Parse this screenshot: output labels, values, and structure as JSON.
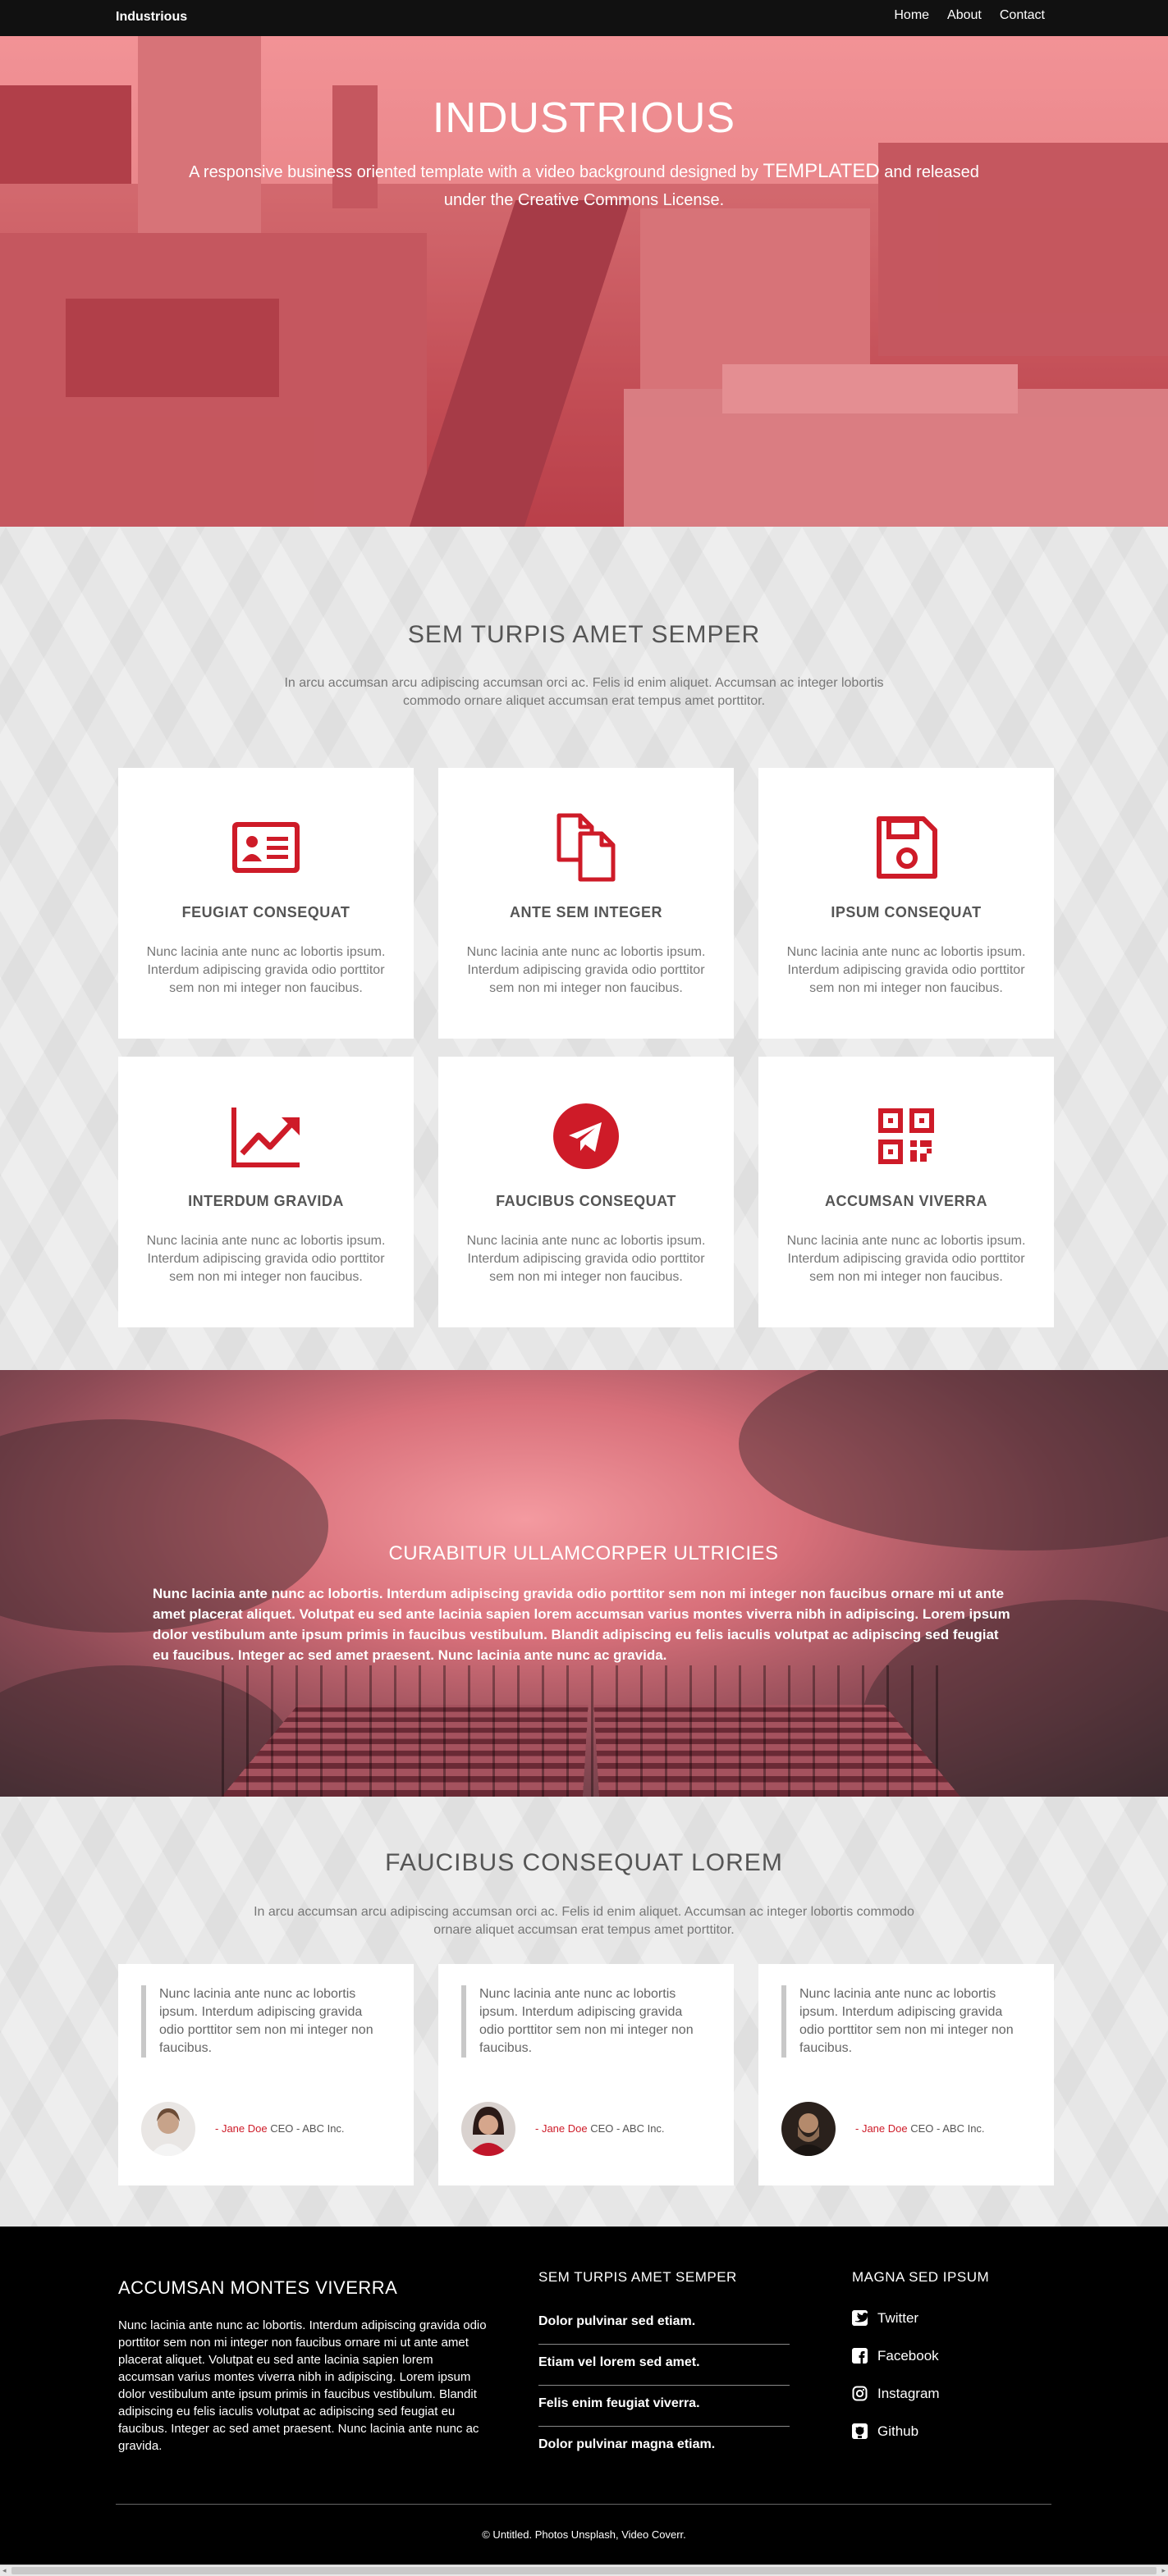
{
  "header": {
    "logo": "Industrious",
    "nav": [
      "Home",
      "About",
      "Contact"
    ]
  },
  "banner": {
    "title": "INDUSTRIOUS",
    "text_before": "A responsive business oriented template with a video background designed by ",
    "templated": "TEMPLATED",
    "text_after": " and released under the Creative Commons License."
  },
  "features": {
    "title": "SEM TURPIS AMET SEMPER",
    "description": "In arcu accumsan arcu adipiscing accumsan orci ac. Felis id enim aliquet. Accumsan ac integer lobortis commodo ornare aliquet accumsan erat tempus amet porttitor.",
    "cards": [
      {
        "icon": "id-card-icon",
        "title": "FEUGIAT CONSEQUAT",
        "text": "Nunc lacinia ante nunc ac lobortis ipsum. Interdum adipiscing gravida odio porttitor sem non mi integer non faucibus."
      },
      {
        "icon": "copy-files-icon",
        "title": "ANTE SEM INTEGER",
        "text": "Nunc lacinia ante nunc ac lobortis ipsum. Interdum adipiscing gravida odio porttitor sem non mi integer non faucibus."
      },
      {
        "icon": "floppy-disk-icon",
        "title": "IPSUM CONSEQUAT",
        "text": "Nunc lacinia ante nunc ac lobortis ipsum. Interdum adipiscing gravida odio porttitor sem non mi integer non faucibus."
      },
      {
        "icon": "chart-line-icon",
        "title": "INTERDUM GRAVIDA",
        "text": "Nunc lacinia ante nunc ac lobortis ipsum. Interdum adipiscing gravida odio porttitor sem non mi integer non faucibus."
      },
      {
        "icon": "paper-plane-icon",
        "title": "FAUCIBUS CONSEQUAT",
        "text": "Nunc lacinia ante nunc ac lobortis ipsum. Interdum adipiscing gravida odio porttitor sem non mi integer non faucibus."
      },
      {
        "icon": "qr-code-icon",
        "title": "ACCUMSAN VIVERRA",
        "text": "Nunc lacinia ante nunc ac lobortis ipsum. Interdum adipiscing gravida odio porttitor sem non mi integer non faucibus."
      }
    ]
  },
  "cta": {
    "title": "CURABITUR ULLAMCORPER ULTRICIES",
    "text": "Nunc lacinia ante nunc ac lobortis. Interdum adipiscing gravida odio porttitor sem non mi integer non faucibus ornare mi ut ante amet placerat aliquet. Volutpat eu sed ante lacinia sapien lorem accumsan varius montes viverra nibh in adipiscing. Lorem ipsum dolor vestibulum ante ipsum primis in faucibus vestibulum. Blandit adipiscing eu felis iaculis volutpat ac adipiscing sed feugiat eu faucibus. Integer ac sed amet praesent. Nunc lacinia ante nunc ac gravida."
  },
  "testimonials": {
    "title": "FAUCIBUS CONSEQUAT LOREM",
    "description": "In arcu accumsan arcu adipiscing accumsan orci ac. Felis id enim aliquet. Accumsan ac integer lobortis commodo ornare aliquet accumsan erat tempus amet porttitor.",
    "items": [
      {
        "quote": "Nunc lacinia ante nunc ac lobortis ipsum. Interdum adipiscing gravida odio porttitor sem non mi integer non faucibus.",
        "name": "Jane Doe",
        "role": "CEO - ABC Inc.",
        "dash": "- "
      },
      {
        "quote": "Nunc lacinia ante nunc ac lobortis ipsum. Interdum adipiscing gravida odio porttitor sem non mi integer non faucibus.",
        "name": "Jane Doe",
        "role": "CEO - ABC Inc.",
        "dash": "- "
      },
      {
        "quote": "Nunc lacinia ante nunc ac lobortis ipsum. Interdum adipiscing gravida odio porttitor sem non mi integer non faucibus.",
        "name": "Jane Doe",
        "role": "CEO - ABC Inc.",
        "dash": "- "
      }
    ]
  },
  "footer": {
    "about_title": "ACCUMSAN MONTES VIVERRA",
    "about_text": "Nunc lacinia ante nunc ac lobortis. Interdum adipiscing gravida odio porttitor sem non mi integer non faucibus ornare mi ut ante amet placerat aliquet. Volutpat eu sed ante lacinia sapien lorem accumsan varius montes viverra nibh in adipiscing. Lorem ipsum dolor vestibulum ante ipsum primis in faucibus vestibulum. Blandit adipiscing eu felis iaculis volutpat ac adipiscing sed feugiat eu faucibus. Integer ac sed amet praesent. Nunc lacinia ante nunc ac gravida.",
    "links_title": "SEM TURPIS AMET SEMPER",
    "links": [
      "Dolor pulvinar sed etiam.",
      "Etiam vel lorem sed amet.",
      "Felis enim feugiat viverra.",
      "Dolor pulvinar magna etiam."
    ],
    "social_title": "MAGNA SED IPSUM",
    "social": [
      {
        "icon": "twitter-icon",
        "label": "Twitter"
      },
      {
        "icon": "facebook-icon",
        "label": "Facebook"
      },
      {
        "icon": "instagram-icon",
        "label": "Instagram"
      },
      {
        "icon": "github-icon",
        "label": "Github"
      }
    ],
    "copyright": "© Untitled. Photos Unsplash, Video Coverr."
  },
  "colors": {
    "accent": "#ce1b28",
    "header_bg": "#111111",
    "footer_bg": "#000000"
  }
}
